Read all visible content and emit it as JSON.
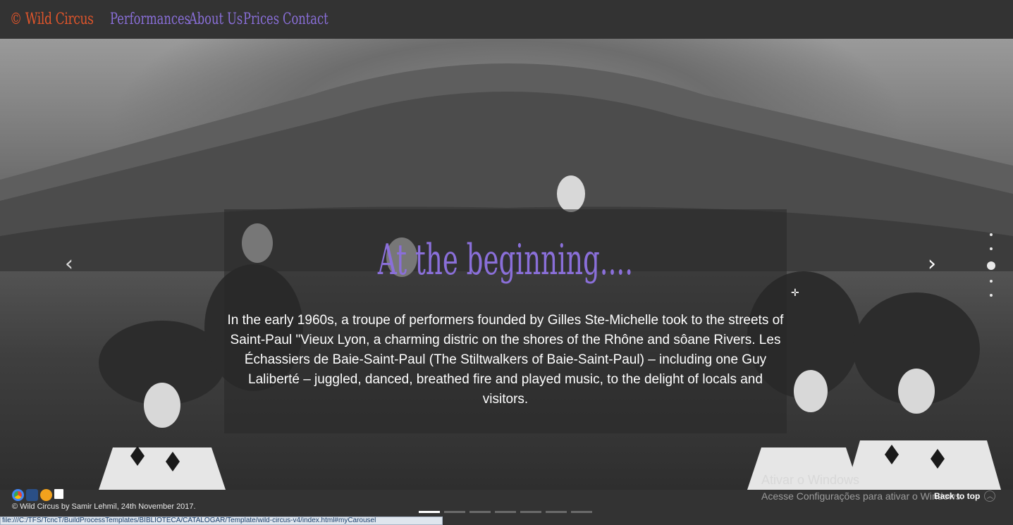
{
  "navbar": {
    "brand": "© Wild Circus",
    "links": [
      "Performances",
      "About Us",
      "Prices",
      "Contact"
    ]
  },
  "carousel": {
    "caption_title": "At the beginning....",
    "caption_text": "In the early 1960s, a troupe of performers founded by Gilles Ste-Michelle took to the streets of Saint-Paul \"Vieux Lyon, a charming distric on the shores of the Rhône and sôane Rivers. Les Échassiers de Baie-Saint-Paul (The Stiltwalkers of Baie-Saint-Paul) – including one Guy Laliberté – juggled, danced, breathed fire and played music, to the delight of locals and visitors.",
    "prev_icon": "chevron-left-icon",
    "next_icon": "chevron-right-icon",
    "prev_glyph": "‹",
    "next_glyph": "›",
    "vertical_dots_count": 5,
    "active_vertical_dot": 3,
    "indicators_count": 7,
    "active_indicator": 1
  },
  "footer": {
    "copyright": "© Wild Circus by Samir Lehmil, 24th November 2017.",
    "activate_title": "Ativar o Windows",
    "activate_sub": "Acesse Configurações para ativar o Windows.",
    "back_to_top": "Back to top",
    "up_glyph": "︿"
  },
  "statusbar": {
    "url": "file:///C:/TFS/TcncT/BuildProcessTemplates/BIBLIOTECA/CATALOGAR/Template/wild-circus-v4/index.html#myCarousel"
  },
  "colors": {
    "brand": "#e0552b",
    "accent": "#8a6fd9",
    "bar": "#333333"
  }
}
